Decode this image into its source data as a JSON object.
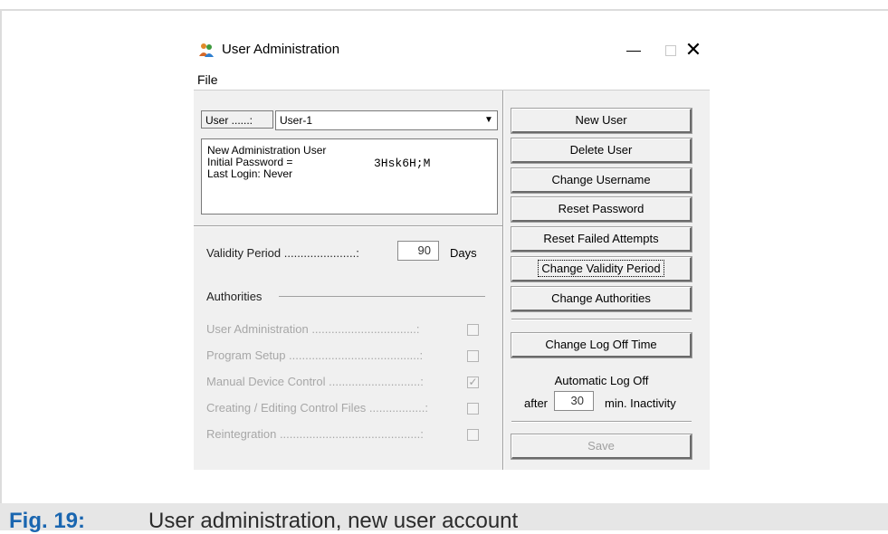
{
  "window": {
    "title": "User Administration",
    "min_symbol": "—",
    "close_symbol": "✕",
    "icon": "users-icon"
  },
  "menu": {
    "file": "File"
  },
  "user": {
    "label": "User ......:",
    "selected": "User-1"
  },
  "info": {
    "line1": "New Administration User",
    "line2": "Initial Password =",
    "password": "3Hsk6H;M",
    "line3": "Last Login: Never"
  },
  "validity": {
    "label": "Validity Period ......................:",
    "value": "90",
    "unit": "Days"
  },
  "authorities": {
    "label": "Authorities",
    "items": [
      {
        "label": "User Administration ................................:",
        "checked": false
      },
      {
        "label": "Program Setup ........................................:",
        "checked": false
      },
      {
        "label": "Manual Device Control ............................:",
        "checked": true
      },
      {
        "label": "Creating / Editing Control Files .................:",
        "checked": false
      },
      {
        "label": "Reintegration ...........................................:",
        "checked": false
      }
    ]
  },
  "buttons": {
    "new_user": "New User",
    "delete_user": "Delete User",
    "change_username": "Change Username",
    "reset_password": "Reset Password",
    "reset_failed": "Reset Failed Attempts",
    "change_validity": "Change Validity Period",
    "change_authorities": "Change Authorities",
    "change_logoff": "Change Log Off Time",
    "save": "Save"
  },
  "logoff": {
    "title": "Automatic Log Off",
    "after": "after",
    "value": "30",
    "unit": "min. Inactivity"
  },
  "caption": {
    "number": "Fig. 19:",
    "text": "User administration, new user account"
  },
  "colors": {
    "caption_accent": "#1a66b0",
    "dialog_bg": "#f0f0f0"
  }
}
